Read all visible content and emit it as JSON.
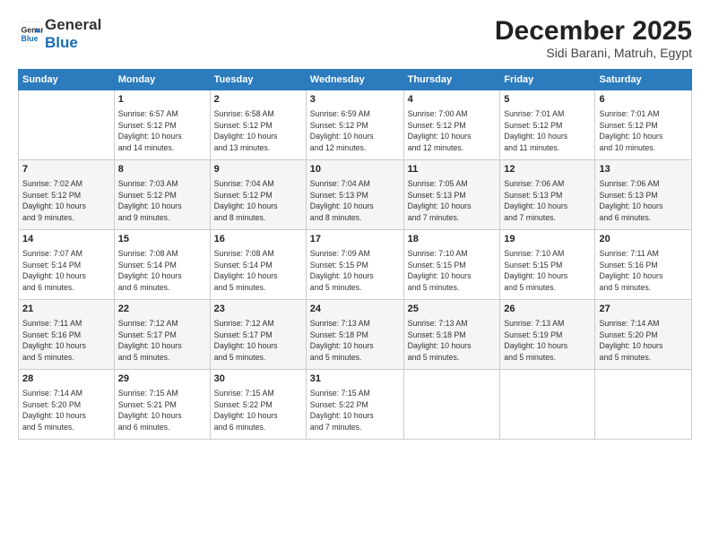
{
  "header": {
    "logo_line1": "General",
    "logo_line2": "Blue",
    "month_title": "December 2025",
    "location": "Sidi Barani, Matruh, Egypt"
  },
  "weekdays": [
    "Sunday",
    "Monday",
    "Tuesday",
    "Wednesday",
    "Thursday",
    "Friday",
    "Saturday"
  ],
  "weeks": [
    [
      {
        "day": "",
        "info": ""
      },
      {
        "day": "1",
        "info": "Sunrise: 6:57 AM\nSunset: 5:12 PM\nDaylight: 10 hours\nand 14 minutes."
      },
      {
        "day": "2",
        "info": "Sunrise: 6:58 AM\nSunset: 5:12 PM\nDaylight: 10 hours\nand 13 minutes."
      },
      {
        "day": "3",
        "info": "Sunrise: 6:59 AM\nSunset: 5:12 PM\nDaylight: 10 hours\nand 12 minutes."
      },
      {
        "day": "4",
        "info": "Sunrise: 7:00 AM\nSunset: 5:12 PM\nDaylight: 10 hours\nand 12 minutes."
      },
      {
        "day": "5",
        "info": "Sunrise: 7:01 AM\nSunset: 5:12 PM\nDaylight: 10 hours\nand 11 minutes."
      },
      {
        "day": "6",
        "info": "Sunrise: 7:01 AM\nSunset: 5:12 PM\nDaylight: 10 hours\nand 10 minutes."
      }
    ],
    [
      {
        "day": "7",
        "info": "Sunrise: 7:02 AM\nSunset: 5:12 PM\nDaylight: 10 hours\nand 9 minutes."
      },
      {
        "day": "8",
        "info": "Sunrise: 7:03 AM\nSunset: 5:12 PM\nDaylight: 10 hours\nand 9 minutes."
      },
      {
        "day": "9",
        "info": "Sunrise: 7:04 AM\nSunset: 5:12 PM\nDaylight: 10 hours\nand 8 minutes."
      },
      {
        "day": "10",
        "info": "Sunrise: 7:04 AM\nSunset: 5:13 PM\nDaylight: 10 hours\nand 8 minutes."
      },
      {
        "day": "11",
        "info": "Sunrise: 7:05 AM\nSunset: 5:13 PM\nDaylight: 10 hours\nand 7 minutes."
      },
      {
        "day": "12",
        "info": "Sunrise: 7:06 AM\nSunset: 5:13 PM\nDaylight: 10 hours\nand 7 minutes."
      },
      {
        "day": "13",
        "info": "Sunrise: 7:06 AM\nSunset: 5:13 PM\nDaylight: 10 hours\nand 6 minutes."
      }
    ],
    [
      {
        "day": "14",
        "info": "Sunrise: 7:07 AM\nSunset: 5:14 PM\nDaylight: 10 hours\nand 6 minutes."
      },
      {
        "day": "15",
        "info": "Sunrise: 7:08 AM\nSunset: 5:14 PM\nDaylight: 10 hours\nand 6 minutes."
      },
      {
        "day": "16",
        "info": "Sunrise: 7:08 AM\nSunset: 5:14 PM\nDaylight: 10 hours\nand 5 minutes."
      },
      {
        "day": "17",
        "info": "Sunrise: 7:09 AM\nSunset: 5:15 PM\nDaylight: 10 hours\nand 5 minutes."
      },
      {
        "day": "18",
        "info": "Sunrise: 7:10 AM\nSunset: 5:15 PM\nDaylight: 10 hours\nand 5 minutes."
      },
      {
        "day": "19",
        "info": "Sunrise: 7:10 AM\nSunset: 5:15 PM\nDaylight: 10 hours\nand 5 minutes."
      },
      {
        "day": "20",
        "info": "Sunrise: 7:11 AM\nSunset: 5:16 PM\nDaylight: 10 hours\nand 5 minutes."
      }
    ],
    [
      {
        "day": "21",
        "info": "Sunrise: 7:11 AM\nSunset: 5:16 PM\nDaylight: 10 hours\nand 5 minutes."
      },
      {
        "day": "22",
        "info": "Sunrise: 7:12 AM\nSunset: 5:17 PM\nDaylight: 10 hours\nand 5 minutes."
      },
      {
        "day": "23",
        "info": "Sunrise: 7:12 AM\nSunset: 5:17 PM\nDaylight: 10 hours\nand 5 minutes."
      },
      {
        "day": "24",
        "info": "Sunrise: 7:13 AM\nSunset: 5:18 PM\nDaylight: 10 hours\nand 5 minutes."
      },
      {
        "day": "25",
        "info": "Sunrise: 7:13 AM\nSunset: 5:18 PM\nDaylight: 10 hours\nand 5 minutes."
      },
      {
        "day": "26",
        "info": "Sunrise: 7:13 AM\nSunset: 5:19 PM\nDaylight: 10 hours\nand 5 minutes."
      },
      {
        "day": "27",
        "info": "Sunrise: 7:14 AM\nSunset: 5:20 PM\nDaylight: 10 hours\nand 5 minutes."
      }
    ],
    [
      {
        "day": "28",
        "info": "Sunrise: 7:14 AM\nSunset: 5:20 PM\nDaylight: 10 hours\nand 5 minutes."
      },
      {
        "day": "29",
        "info": "Sunrise: 7:15 AM\nSunset: 5:21 PM\nDaylight: 10 hours\nand 6 minutes."
      },
      {
        "day": "30",
        "info": "Sunrise: 7:15 AM\nSunset: 5:22 PM\nDaylight: 10 hours\nand 6 minutes."
      },
      {
        "day": "31",
        "info": "Sunrise: 7:15 AM\nSunset: 5:22 PM\nDaylight: 10 hours\nand 7 minutes."
      },
      {
        "day": "",
        "info": ""
      },
      {
        "day": "",
        "info": ""
      },
      {
        "day": "",
        "info": ""
      }
    ]
  ]
}
